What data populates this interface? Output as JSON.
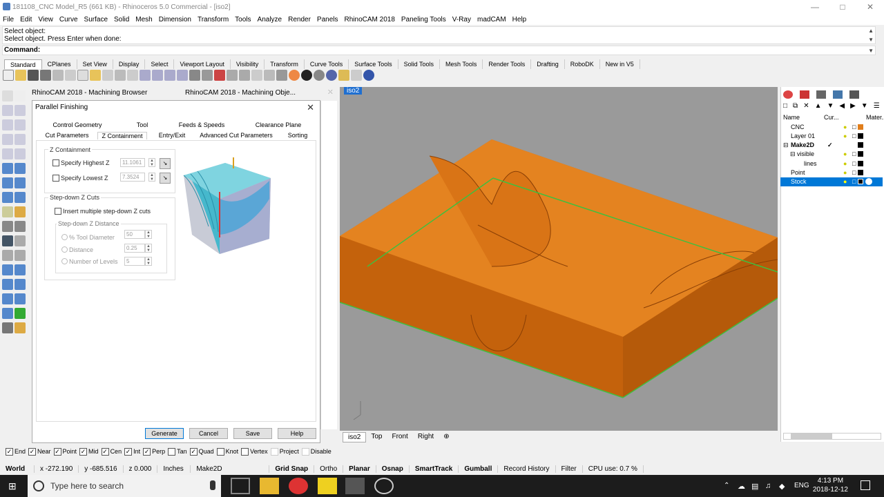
{
  "window": {
    "title": "181108_CNC Model_R5 (661 KB) - Rhinoceros 5.0 Commercial - [iso2]"
  },
  "menu": [
    "File",
    "Edit",
    "View",
    "Curve",
    "Surface",
    "Solid",
    "Mesh",
    "Dimension",
    "Transform",
    "Tools",
    "Analyze",
    "Render",
    "Panels",
    "RhinoCAM 2018",
    "Paneling Tools",
    "V-Ray",
    "madCAM",
    "Help"
  ],
  "command": {
    "history1": "Select object:",
    "history2": "Select object. Press Enter when done:",
    "prompt": "Command:"
  },
  "toolbar_tabs": [
    "Standard",
    "CPlanes",
    "Set View",
    "Display",
    "Select",
    "Viewport Layout",
    "Visibility",
    "Transform",
    "Curve Tools",
    "Surface Tools",
    "Solid Tools",
    "Mesh Tools",
    "Render Tools",
    "Drafting",
    "RoboDK",
    "New in V5"
  ],
  "browser_tabs": [
    "RhinoCAM 2018 - Machining Browser",
    "RhinoCAM 2018 - Machining Obje..."
  ],
  "dialog": {
    "title": "Parallel Finishing",
    "tabs_row1": [
      "Control Geometry",
      "Tool",
      "Feeds & Speeds",
      "Clearance Plane"
    ],
    "tabs_row2": [
      "Cut Parameters",
      "Z Containment",
      "Entry/Exit",
      "Advanced Cut Parameters",
      "Sorting"
    ],
    "zc_group": "Z Containment",
    "specify_highest": "Specify Highest Z",
    "highest_val": "11.1061",
    "specify_lowest": "Specify Lowest Z",
    "lowest_val": "7.3524",
    "stepdown_group": "Step-down Z Cuts",
    "insert_multiple": "Insert multiple step-down Z cuts",
    "distance_group": "Step-down Z Distance",
    "opt_tool_dia": "% Tool Diameter",
    "val_tool_dia": "50",
    "opt_distance": "Distance",
    "val_distance": "0.25",
    "opt_levels": "Number of Levels",
    "val_levels": "5",
    "btn_generate": "Generate",
    "btn_cancel": "Cancel",
    "btn_save": "Save",
    "btn_help": "Help"
  },
  "viewport": {
    "label": "iso2",
    "tabs": [
      "iso2",
      "Top",
      "Front",
      "Right"
    ],
    "stock_color": "#e07e1c"
  },
  "layers": {
    "header": {
      "name": "Name",
      "current": "Cur...",
      "material": "Mater..."
    },
    "rows": [
      {
        "name": "CNC",
        "indent": 0
      },
      {
        "name": "Layer 01",
        "indent": 0
      },
      {
        "name": "Make2D",
        "indent": 0
      },
      {
        "name": "visible",
        "indent": 1
      },
      {
        "name": "lines",
        "indent": 2
      },
      {
        "name": "Point",
        "indent": 0
      },
      {
        "name": "Stock",
        "indent": 0
      }
    ]
  },
  "osnaps": [
    {
      "label": "End",
      "on": true
    },
    {
      "label": "Near",
      "on": true
    },
    {
      "label": "Point",
      "on": true
    },
    {
      "label": "Mid",
      "on": true
    },
    {
      "label": "Cen",
      "on": true
    },
    {
      "label": "Int",
      "on": true
    },
    {
      "label": "Perp",
      "on": true
    },
    {
      "label": "Tan",
      "on": false
    },
    {
      "label": "Quad",
      "on": true
    },
    {
      "label": "Knot",
      "on": false
    },
    {
      "label": "Vertex",
      "on": false
    },
    {
      "label": "Project",
      "on": false
    },
    {
      "label": "Disable",
      "on": false
    }
  ],
  "status": {
    "cplane": "World",
    "x": "x -272.190",
    "y": "y -685.516",
    "z": "z 0.000",
    "units": "Inches",
    "layer": "Make2D",
    "grid_snap": "Grid Snap",
    "ortho": "Ortho",
    "planar": "Planar",
    "osnap": "Osnap",
    "smarttrack": "SmartTrack",
    "gumball": "Gumball",
    "record": "Record History",
    "filter": "Filter",
    "cpu": "CPU use: 0.7 %"
  },
  "taskbar": {
    "search": "Type here to search",
    "lang": "ENG",
    "time": "4:13 PM",
    "date": "2018-12-12"
  }
}
